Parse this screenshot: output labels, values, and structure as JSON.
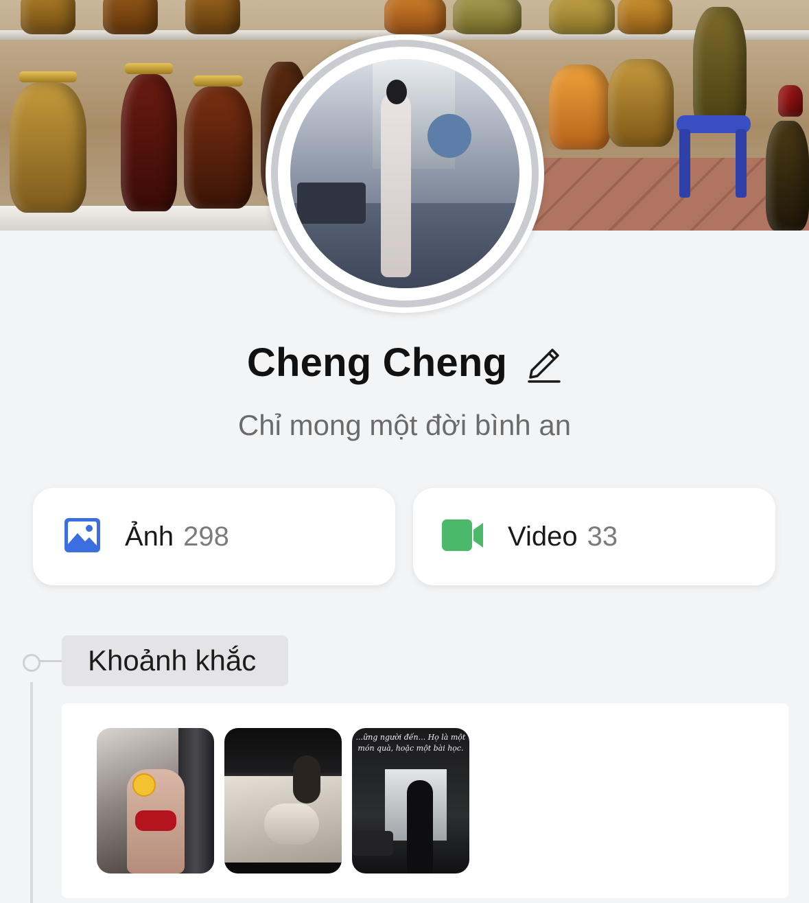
{
  "profile": {
    "name": "Cheng Cheng",
    "bio": "Chỉ mong một đời bình an"
  },
  "stats": {
    "photos": {
      "label": "Ảnh",
      "count": "298",
      "icon": "photo-gallery-icon",
      "color": "#3b6fe0"
    },
    "videos": {
      "label": "Video",
      "count": "33",
      "icon": "video-camera-icon",
      "color": "#4bb969"
    }
  },
  "moments": {
    "title": "Khoảnh khắc",
    "thumbnails": [
      {
        "caption": ""
      },
      {
        "caption": ""
      },
      {
        "caption": "...ững người đến... Họ là một món quà, hoặc một bài học."
      }
    ]
  }
}
